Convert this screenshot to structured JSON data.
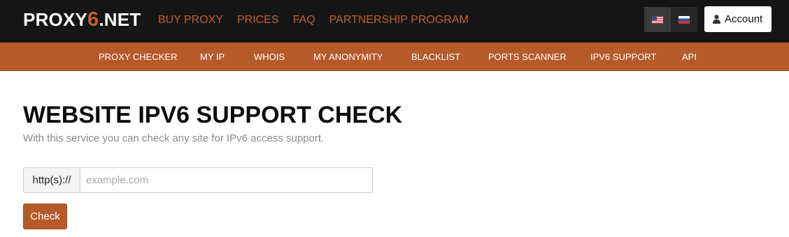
{
  "brand": {
    "logo_prefix": "PROXY",
    "logo_accent": "6",
    "logo_suffix": ".NET"
  },
  "top_nav": [
    {
      "label": "BUY PROXY"
    },
    {
      "label": "PRICES"
    },
    {
      "label": "FAQ"
    },
    {
      "label": "PARTNERSHIP PROGRAM"
    }
  ],
  "languages": [
    {
      "icon": "us-flag-icon",
      "active": true
    },
    {
      "icon": "ru-flag-icon",
      "active": false
    }
  ],
  "account": {
    "label": "Account",
    "icon": "user-icon"
  },
  "sub_nav": [
    {
      "label": "PROXY CHECKER"
    },
    {
      "label": "MY IP"
    },
    {
      "label": "WHOIS"
    },
    {
      "label": "MY ANONYMITY"
    },
    {
      "label": "BLACKLIST"
    },
    {
      "label": "PORTS SCANNER"
    },
    {
      "label": "IPV6 SUPPORT"
    },
    {
      "label": "API"
    }
  ],
  "page": {
    "title": "WEBSITE IPV6 SUPPORT CHECK",
    "subtitle": "With this service you can check any site for IPv6 access support."
  },
  "form": {
    "prefix": "http(s)://",
    "input_value": "",
    "input_placeholder": "example.com",
    "submit_label": "Check"
  },
  "colors": {
    "accent": "#c2602b",
    "subnav_bg": "#b55a28",
    "topbar_bg": "#151515"
  }
}
